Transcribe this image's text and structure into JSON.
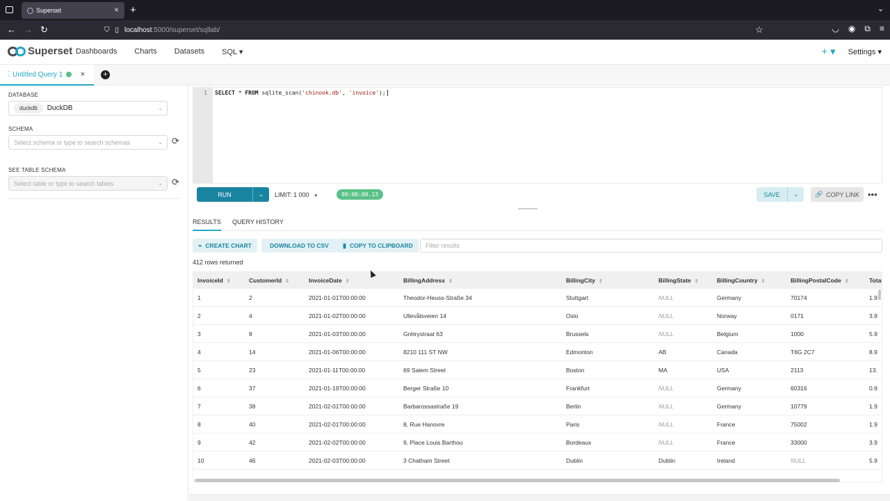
{
  "browser": {
    "tab_title": "Superset",
    "url_host": "localhost",
    "url_path": ":5000/superset/sqllab/"
  },
  "app": {
    "brand": "Superset",
    "menu": [
      "Dashboards",
      "Charts",
      "Datasets",
      "SQL ▾"
    ],
    "settings": "Settings ▾",
    "plus": "+ ▾"
  },
  "query_tab": {
    "label": "Untitled Query 1",
    "close": "×",
    "add": "+"
  },
  "left": {
    "database_label": "DATABASE",
    "database_tag": "duckdb",
    "database_value": "DuckDB",
    "schema_label": "SCHEMA",
    "schema_placeholder": "Select schema or type to search schemas",
    "table_label": "SEE TABLE SCHEMA",
    "table_placeholder": "Select table or type to search tables"
  },
  "editor": {
    "line_number": "1",
    "sql_kw1": "SELECT",
    "sql_star": " * ",
    "sql_kw2": "FROM",
    "sql_fn": " sqlite_scan(",
    "sql_str1": "'chinook.db'",
    "sql_comma": ", ",
    "sql_str2": "'invoice'",
    "sql_end": ");"
  },
  "toolbar": {
    "run": "RUN",
    "limit": "LIMIT: 1 000",
    "timer": "00:00:00.13",
    "save": "SAVE",
    "copy_link": "COPY LINK",
    "more": "•••"
  },
  "results": {
    "tab_results": "RESULTS",
    "tab_history": "QUERY HISTORY",
    "create_chart": "CREATE CHART",
    "download_csv": "DOWNLOAD TO CSV",
    "copy_clipboard": "COPY TO CLIPBOARD",
    "filter_placeholder": "Filter results",
    "rows_returned": "412 rows returned"
  },
  "table": {
    "columns": [
      "InvoiceId",
      "CustomerId",
      "InvoiceDate",
      "BillingAddress",
      "BillingCity",
      "BillingState",
      "BillingCountry",
      "BillingPostalCode",
      "Total"
    ],
    "rows": [
      [
        "1",
        "2",
        "2021-01-01T00:00:00",
        "Theodor-Heuss-Straße 34",
        "Stuttgart",
        "NULL",
        "Germany",
        "70174",
        "1.9"
      ],
      [
        "2",
        "4",
        "2021-01-02T00:00:00",
        "Ullevålsveien 14",
        "Oslo",
        "NULL",
        "Norway",
        "0171",
        "3.9"
      ],
      [
        "3",
        "8",
        "2021-01-03T00:00:00",
        "Grétrystraat 63",
        "Brussels",
        "NULL",
        "Belgium",
        "1000",
        "5.9"
      ],
      [
        "4",
        "14",
        "2021-01-06T00:00:00",
        "8210 111 ST NW",
        "Edmonton",
        "AB",
        "Canada",
        "T6G 2C7",
        "8.9"
      ],
      [
        "5",
        "23",
        "2021-01-11T00:00:00",
        "69 Salem Street",
        "Boston",
        "MA",
        "USA",
        "2113",
        "13."
      ],
      [
        "6",
        "37",
        "2021-01-19T00:00:00",
        "Berger Straße 10",
        "Frankfurt",
        "NULL",
        "Germany",
        "60316",
        "0.9"
      ],
      [
        "7",
        "38",
        "2021-02-01T00:00:00",
        "Barbarossastraße 19",
        "Berlin",
        "NULL",
        "Germany",
        "10779",
        "1.9"
      ],
      [
        "8",
        "40",
        "2021-02-01T00:00:00",
        "8, Rue Hanovre",
        "Paris",
        "NULL",
        "France",
        "75002",
        "1.9"
      ],
      [
        "9",
        "42",
        "2021-02-02T00:00:00",
        "9, Place Louis Barthou",
        "Bordeaux",
        "NULL",
        "France",
        "33000",
        "3.9"
      ],
      [
        "10",
        "46",
        "2021-02-03T00:00:00",
        "3 Chatham Street",
        "Dublin",
        "Dublin",
        "Ireland",
        "NULL",
        "5.9"
      ]
    ]
  }
}
